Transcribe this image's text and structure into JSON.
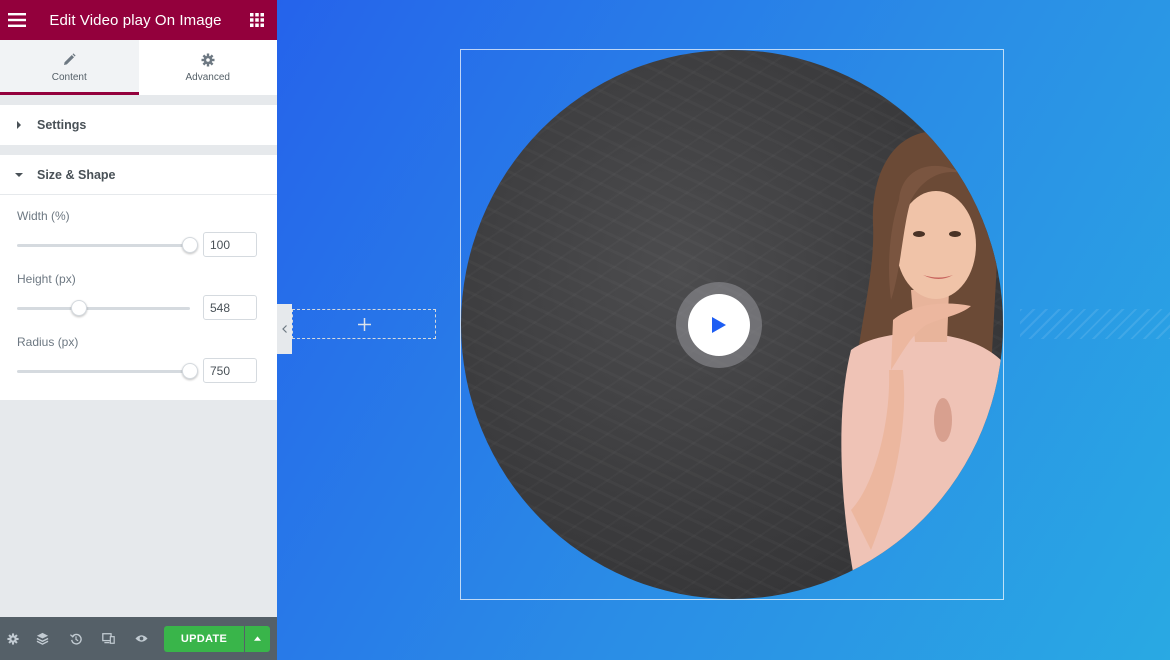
{
  "panel": {
    "title": "Edit Video play On Image",
    "menu_icon": "hamburger-icon",
    "apps_icon": "grid-apps-icon"
  },
  "tabs": [
    {
      "label": "Content",
      "icon": "pencil-icon",
      "active": true
    },
    {
      "label": "Advanced",
      "icon": "gear-icon",
      "active": false
    }
  ],
  "sections": {
    "settings": {
      "label": "Settings",
      "expanded": false
    },
    "size_shape": {
      "label": "Size & Shape",
      "expanded": true
    }
  },
  "controls": {
    "width": {
      "label": "Width (%)",
      "value": "100",
      "level": 1.0
    },
    "height": {
      "label": "Height (px)",
      "value": "548",
      "level": 0.36
    },
    "radius": {
      "label": "Radius (px)",
      "value": "750",
      "level": 1.0
    }
  },
  "footer": {
    "icons": [
      "settings-icon",
      "layers-icon",
      "history-icon",
      "responsive-icon",
      "preview-eye-icon"
    ],
    "update_label": "UPDATE"
  },
  "colors": {
    "brand": "#93003c",
    "update_green": "#39b54a",
    "canvas_gradient_start": "#2563eb",
    "canvas_gradient_end": "#29a9e3"
  }
}
